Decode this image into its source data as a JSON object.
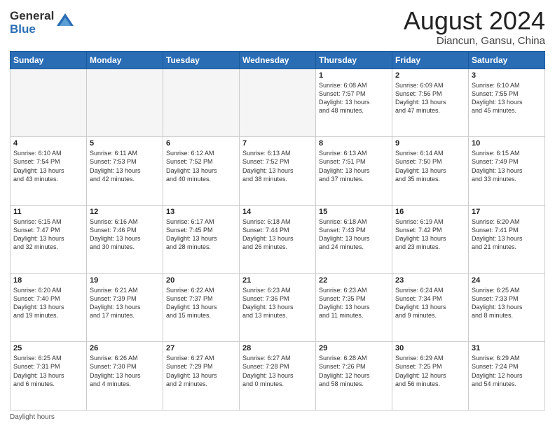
{
  "header": {
    "logo_general": "General",
    "logo_blue": "Blue",
    "month_year": "August 2024",
    "location": "Diancun, Gansu, China"
  },
  "weekdays": [
    "Sunday",
    "Monday",
    "Tuesday",
    "Wednesday",
    "Thursday",
    "Friday",
    "Saturday"
  ],
  "weeks": [
    [
      {
        "day": "",
        "info": "",
        "empty": true
      },
      {
        "day": "",
        "info": "",
        "empty": true
      },
      {
        "day": "",
        "info": "",
        "empty": true
      },
      {
        "day": "",
        "info": "",
        "empty": true
      },
      {
        "day": "1",
        "info": "Sunrise: 6:08 AM\nSunset: 7:57 PM\nDaylight: 13 hours\nand 48 minutes.",
        "empty": false
      },
      {
        "day": "2",
        "info": "Sunrise: 6:09 AM\nSunset: 7:56 PM\nDaylight: 13 hours\nand 47 minutes.",
        "empty": false
      },
      {
        "day": "3",
        "info": "Sunrise: 6:10 AM\nSunset: 7:55 PM\nDaylight: 13 hours\nand 45 minutes.",
        "empty": false
      }
    ],
    [
      {
        "day": "4",
        "info": "Sunrise: 6:10 AM\nSunset: 7:54 PM\nDaylight: 13 hours\nand 43 minutes.",
        "empty": false
      },
      {
        "day": "5",
        "info": "Sunrise: 6:11 AM\nSunset: 7:53 PM\nDaylight: 13 hours\nand 42 minutes.",
        "empty": false
      },
      {
        "day": "6",
        "info": "Sunrise: 6:12 AM\nSunset: 7:52 PM\nDaylight: 13 hours\nand 40 minutes.",
        "empty": false
      },
      {
        "day": "7",
        "info": "Sunrise: 6:13 AM\nSunset: 7:52 PM\nDaylight: 13 hours\nand 38 minutes.",
        "empty": false
      },
      {
        "day": "8",
        "info": "Sunrise: 6:13 AM\nSunset: 7:51 PM\nDaylight: 13 hours\nand 37 minutes.",
        "empty": false
      },
      {
        "day": "9",
        "info": "Sunrise: 6:14 AM\nSunset: 7:50 PM\nDaylight: 13 hours\nand 35 minutes.",
        "empty": false
      },
      {
        "day": "10",
        "info": "Sunrise: 6:15 AM\nSunset: 7:49 PM\nDaylight: 13 hours\nand 33 minutes.",
        "empty": false
      }
    ],
    [
      {
        "day": "11",
        "info": "Sunrise: 6:15 AM\nSunset: 7:47 PM\nDaylight: 13 hours\nand 32 minutes.",
        "empty": false
      },
      {
        "day": "12",
        "info": "Sunrise: 6:16 AM\nSunset: 7:46 PM\nDaylight: 13 hours\nand 30 minutes.",
        "empty": false
      },
      {
        "day": "13",
        "info": "Sunrise: 6:17 AM\nSunset: 7:45 PM\nDaylight: 13 hours\nand 28 minutes.",
        "empty": false
      },
      {
        "day": "14",
        "info": "Sunrise: 6:18 AM\nSunset: 7:44 PM\nDaylight: 13 hours\nand 26 minutes.",
        "empty": false
      },
      {
        "day": "15",
        "info": "Sunrise: 6:18 AM\nSunset: 7:43 PM\nDaylight: 13 hours\nand 24 minutes.",
        "empty": false
      },
      {
        "day": "16",
        "info": "Sunrise: 6:19 AM\nSunset: 7:42 PM\nDaylight: 13 hours\nand 23 minutes.",
        "empty": false
      },
      {
        "day": "17",
        "info": "Sunrise: 6:20 AM\nSunset: 7:41 PM\nDaylight: 13 hours\nand 21 minutes.",
        "empty": false
      }
    ],
    [
      {
        "day": "18",
        "info": "Sunrise: 6:20 AM\nSunset: 7:40 PM\nDaylight: 13 hours\nand 19 minutes.",
        "empty": false
      },
      {
        "day": "19",
        "info": "Sunrise: 6:21 AM\nSunset: 7:39 PM\nDaylight: 13 hours\nand 17 minutes.",
        "empty": false
      },
      {
        "day": "20",
        "info": "Sunrise: 6:22 AM\nSunset: 7:37 PM\nDaylight: 13 hours\nand 15 minutes.",
        "empty": false
      },
      {
        "day": "21",
        "info": "Sunrise: 6:23 AM\nSunset: 7:36 PM\nDaylight: 13 hours\nand 13 minutes.",
        "empty": false
      },
      {
        "day": "22",
        "info": "Sunrise: 6:23 AM\nSunset: 7:35 PM\nDaylight: 13 hours\nand 11 minutes.",
        "empty": false
      },
      {
        "day": "23",
        "info": "Sunrise: 6:24 AM\nSunset: 7:34 PM\nDaylight: 13 hours\nand 9 minutes.",
        "empty": false
      },
      {
        "day": "24",
        "info": "Sunrise: 6:25 AM\nSunset: 7:33 PM\nDaylight: 13 hours\nand 8 minutes.",
        "empty": false
      }
    ],
    [
      {
        "day": "25",
        "info": "Sunrise: 6:25 AM\nSunset: 7:31 PM\nDaylight: 13 hours\nand 6 minutes.",
        "empty": false
      },
      {
        "day": "26",
        "info": "Sunrise: 6:26 AM\nSunset: 7:30 PM\nDaylight: 13 hours\nand 4 minutes.",
        "empty": false
      },
      {
        "day": "27",
        "info": "Sunrise: 6:27 AM\nSunset: 7:29 PM\nDaylight: 13 hours\nand 2 minutes.",
        "empty": false
      },
      {
        "day": "28",
        "info": "Sunrise: 6:27 AM\nSunset: 7:28 PM\nDaylight: 13 hours\nand 0 minutes.",
        "empty": false
      },
      {
        "day": "29",
        "info": "Sunrise: 6:28 AM\nSunset: 7:26 PM\nDaylight: 12 hours\nand 58 minutes.",
        "empty": false
      },
      {
        "day": "30",
        "info": "Sunrise: 6:29 AM\nSunset: 7:25 PM\nDaylight: 12 hours\nand 56 minutes.",
        "empty": false
      },
      {
        "day": "31",
        "info": "Sunrise: 6:29 AM\nSunset: 7:24 PM\nDaylight: 12 hours\nand 54 minutes.",
        "empty": false
      }
    ]
  ],
  "footer": {
    "note": "Daylight hours"
  }
}
